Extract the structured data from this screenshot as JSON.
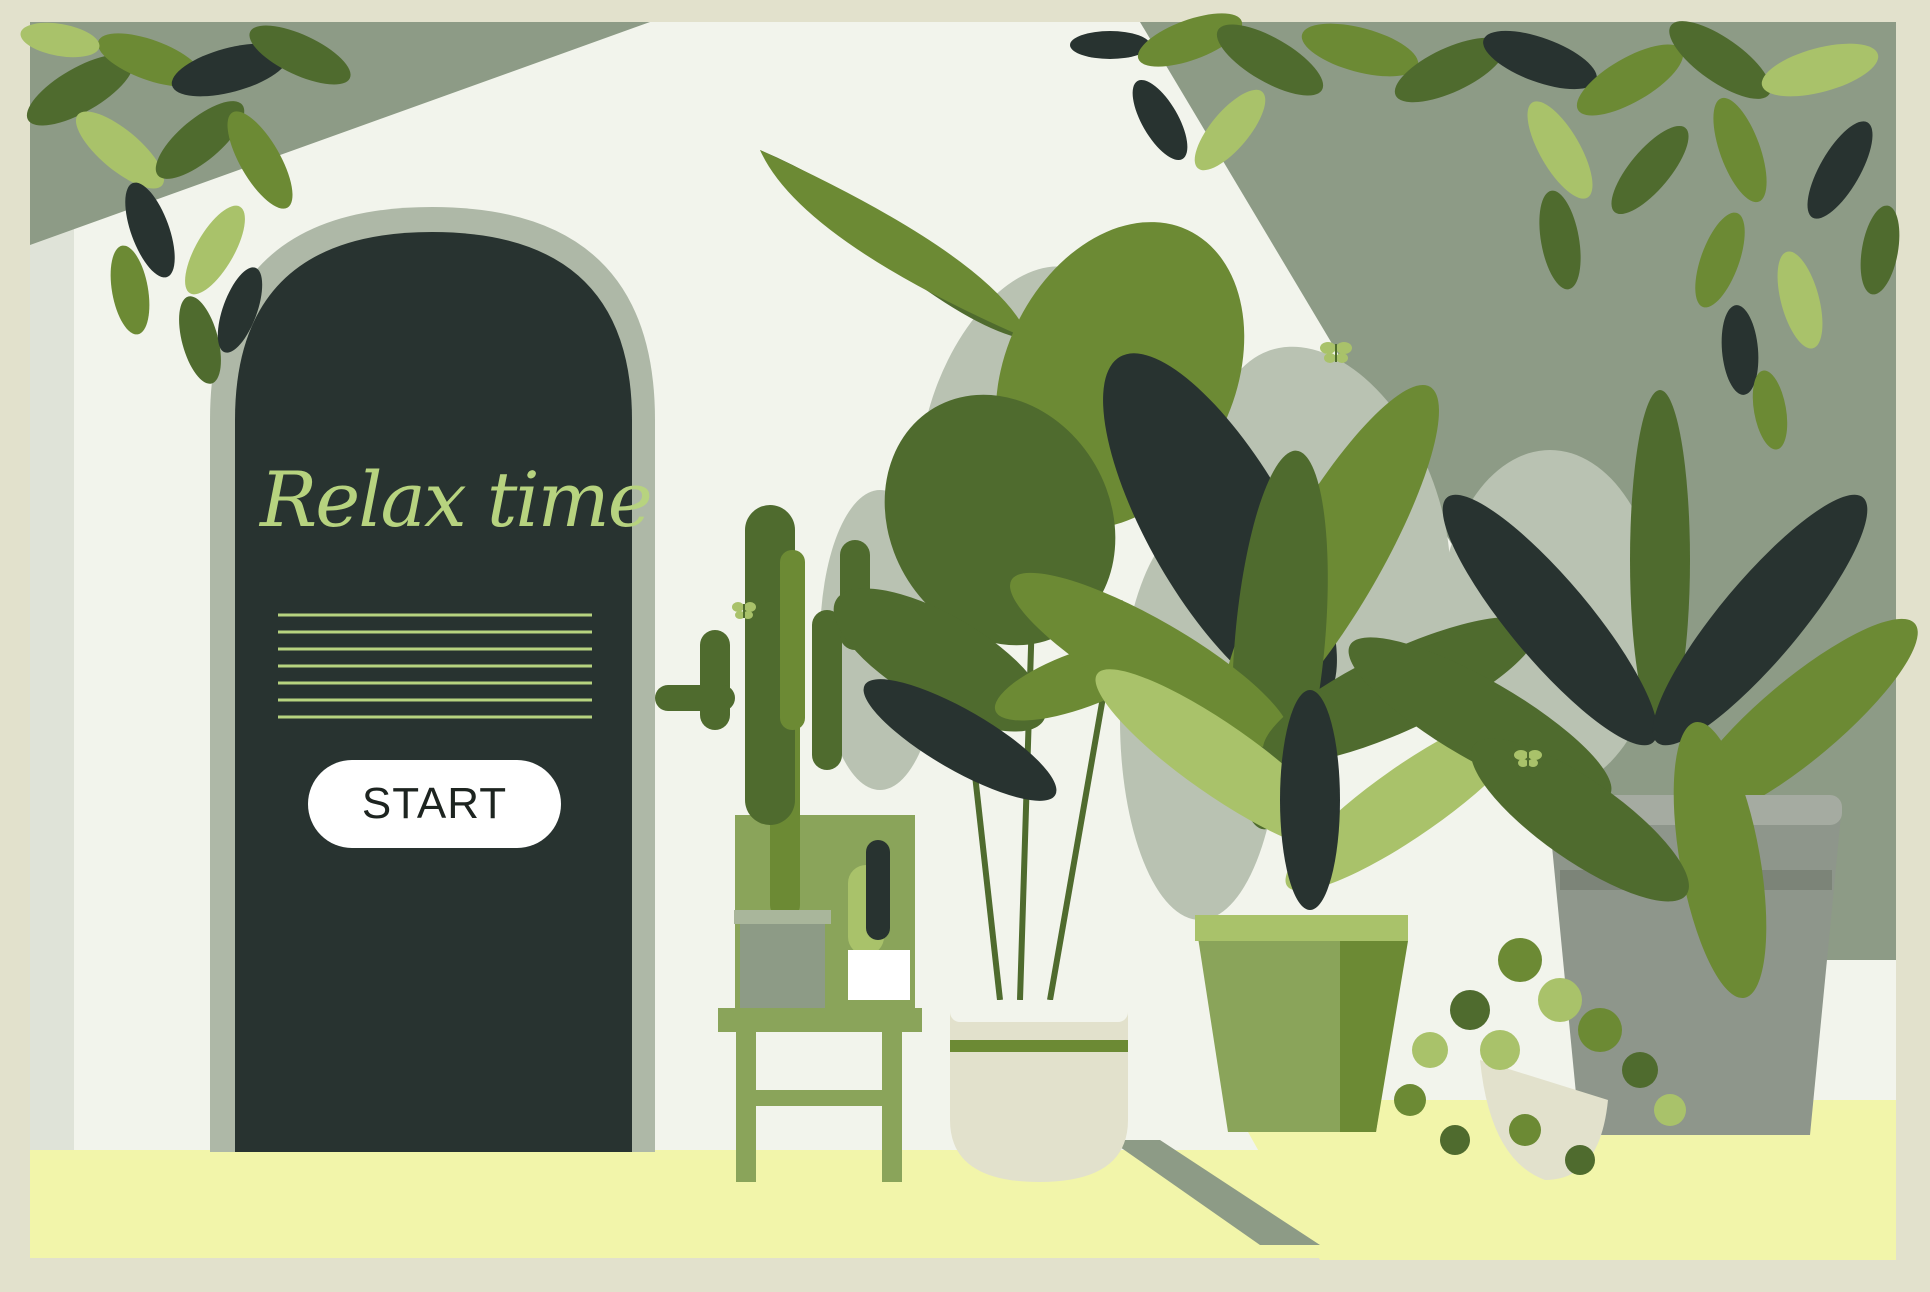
{
  "title": "Relax time",
  "start_button": {
    "label": "START"
  },
  "colors": {
    "frame": "#e2e1cc",
    "wall": "#f2f4ec",
    "floor": "#f2f5aa",
    "door": "#283330",
    "door_arch": "#aeb8a7",
    "title_green": "#b7d37f",
    "leaf_dark": "#4f6b2e",
    "leaf_mid": "#6c8a34",
    "leaf_light": "#a9c26a",
    "pot_grey": "#8e968b",
    "shadow": "#8d9b86"
  },
  "icons": [
    "butterfly-icon",
    "butterfly-icon",
    "butterfly-icon"
  ]
}
